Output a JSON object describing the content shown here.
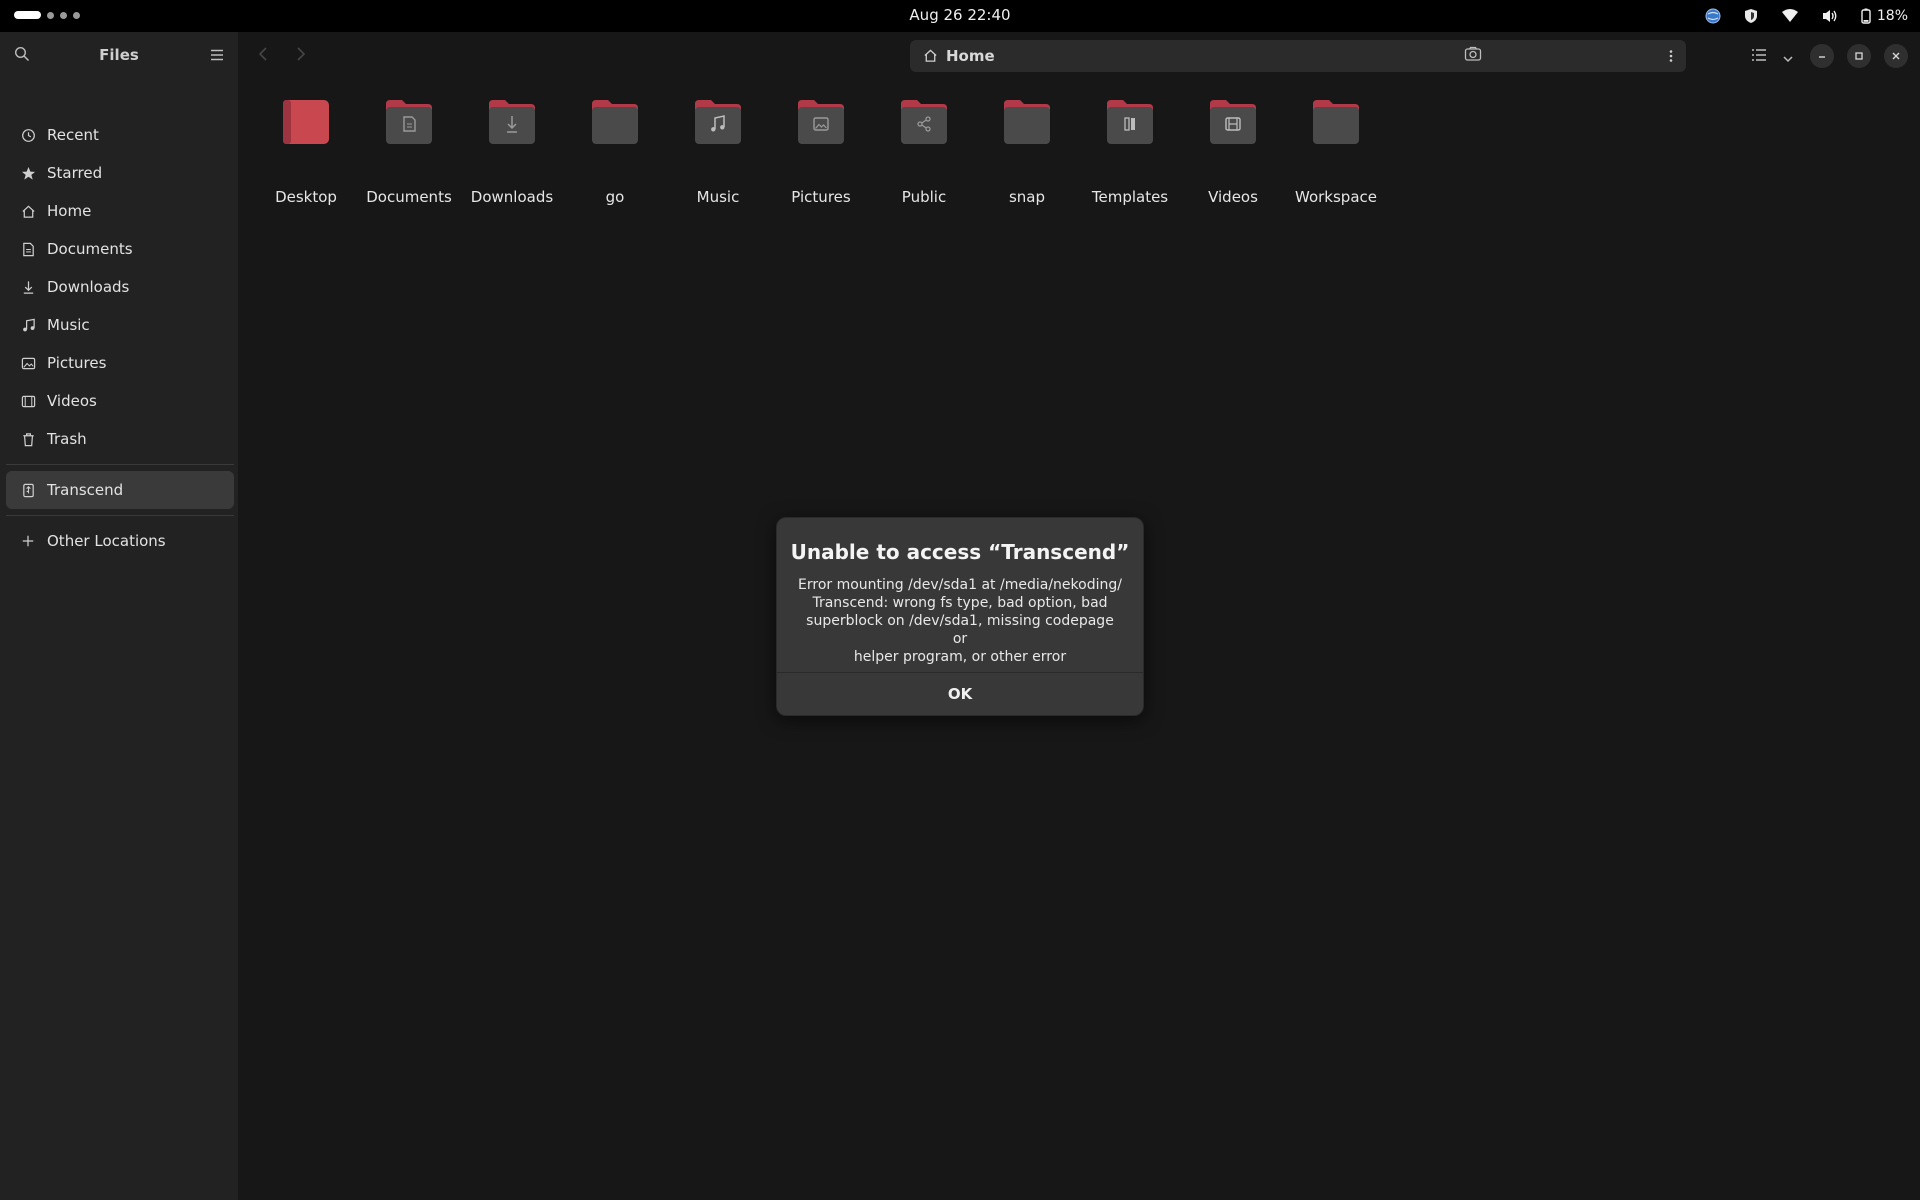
{
  "topbar": {
    "clock": "Aug 26  22:40",
    "battery": "18%"
  },
  "sidebar": {
    "title": "Files",
    "places": [
      {
        "label": "Recent",
        "icon": "clock-icon"
      },
      {
        "label": "Starred",
        "icon": "star-icon"
      },
      {
        "label": "Home",
        "icon": "home-icon"
      },
      {
        "label": "Documents",
        "icon": "document-icon"
      },
      {
        "label": "Downloads",
        "icon": "download-icon"
      },
      {
        "label": "Music",
        "icon": "music-icon"
      },
      {
        "label": "Pictures",
        "icon": "picture-icon"
      },
      {
        "label": "Videos",
        "icon": "video-icon"
      },
      {
        "label": "Trash",
        "icon": "trash-icon"
      }
    ],
    "devices": [
      {
        "label": "Transcend",
        "icon": "usb-drive-icon"
      }
    ],
    "other": {
      "label": "Other Locations",
      "icon": "plus-icon"
    }
  },
  "pathbar": {
    "location": "Home"
  },
  "folders": [
    {
      "label": "Desktop",
      "icon": "desktop-folder-icon"
    },
    {
      "label": "Documents",
      "icon": "documents-folder-icon"
    },
    {
      "label": "Downloads",
      "icon": "downloads-folder-icon"
    },
    {
      "label": "go",
      "icon": "folder-icon"
    },
    {
      "label": "Music",
      "icon": "music-folder-icon"
    },
    {
      "label": "Pictures",
      "icon": "pictures-folder-icon"
    },
    {
      "label": "Public",
      "icon": "public-folder-icon"
    },
    {
      "label": "snap",
      "icon": "folder-icon"
    },
    {
      "label": "Templates",
      "icon": "templates-folder-icon"
    },
    {
      "label": "Videos",
      "icon": "videos-folder-icon"
    },
    {
      "label": "Workspace",
      "icon": "folder-icon"
    }
  ],
  "dialog": {
    "title": "Unable to access “Transcend”",
    "message_lines": [
      "Error mounting /dev/sda1 at /media/nekoding/",
      "Transcend: wrong fs type, bad option, bad",
      "superblock on /dev/sda1, missing codepage or",
      "helper program, or other error"
    ],
    "ok_label": "OK"
  },
  "colors": {
    "folder_top": "#b23a48",
    "folder_body": "#4a4a4a",
    "desktop_folder": "#c9474f",
    "background": "#171717",
    "sidebar": "#222222"
  }
}
